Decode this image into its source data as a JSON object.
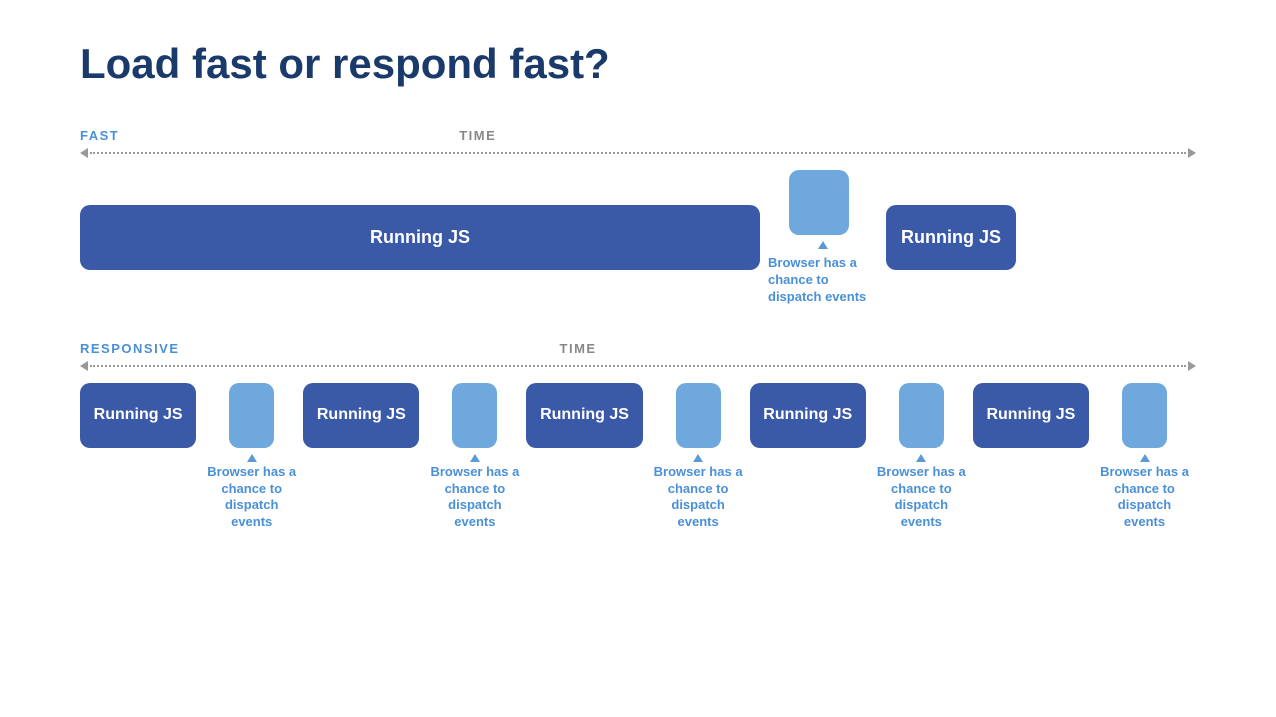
{
  "title": "Load fast or respond fast?",
  "fast_section": {
    "label": "FAST",
    "time_label": "TIME",
    "running_js_label": "Running JS",
    "running_js2_label": "Running JS",
    "browser_event_text": "Browser has a chance to dispatch events"
  },
  "responsive_section": {
    "label": "RESPONSIVE",
    "time_label": "TIME",
    "running_js_label": "Running JS",
    "browser_event_text": "Browser has a chance to dispatch events",
    "blocks": [
      {
        "type": "run",
        "label": "Running JS"
      },
      {
        "type": "gap",
        "label": "Browser has a chance to dispatch events"
      },
      {
        "type": "run",
        "label": "Running JS"
      },
      {
        "type": "gap",
        "label": "Browser has a chance to dispatch events"
      },
      {
        "type": "run",
        "label": "Running JS"
      },
      {
        "type": "gap",
        "label": "Browser has a chance to dispatch events"
      },
      {
        "type": "run",
        "label": "Running JS"
      },
      {
        "type": "gap",
        "label": "Browser has a chance to dispatch events"
      },
      {
        "type": "run",
        "label": "Running JS"
      },
      {
        "type": "gap",
        "label": "Browser has a chance to dispatch events"
      }
    ]
  }
}
